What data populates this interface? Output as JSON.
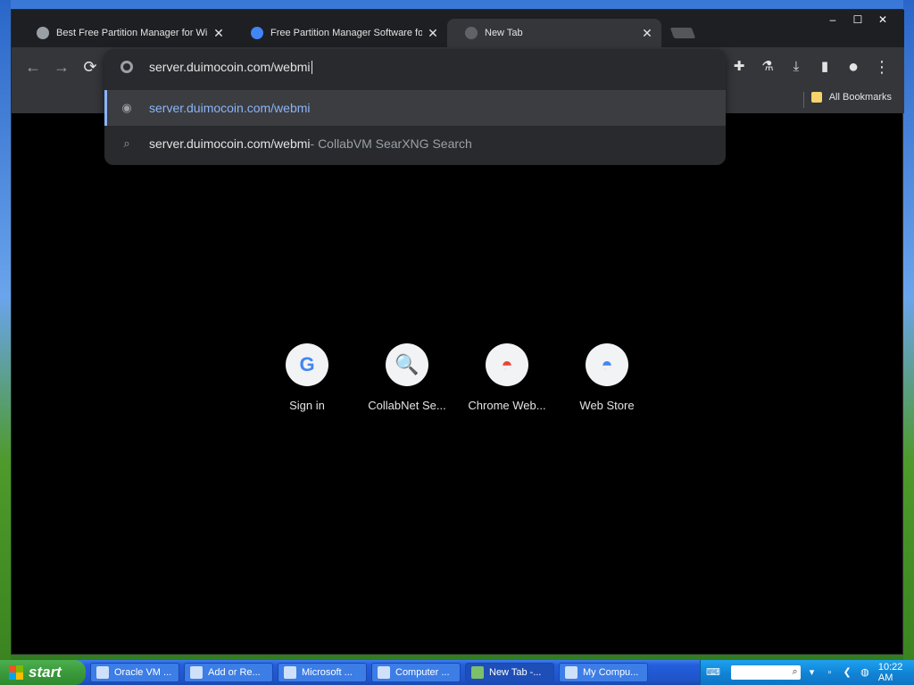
{
  "window": {
    "minimize": "–",
    "maximize": "☐",
    "close": "✕"
  },
  "tabs": [
    {
      "title": "Best Free Partition Manager for Wi",
      "close": "✕",
      "favicon_color": "#9aa0a6"
    },
    {
      "title": "Free Partition Manager Software fo",
      "close": "✕",
      "favicon_color": "#4285f4"
    },
    {
      "title": "New Tab",
      "close": "✕",
      "favicon_color": "#5f6368"
    }
  ],
  "toolbar": {
    "back": "←",
    "forward": "→",
    "reload": "⟳",
    "extensions": "✚",
    "labs": "⚗",
    "download": "⤓",
    "sidepanel": "▮",
    "profile": "●",
    "menu": "⋮"
  },
  "omnibox": {
    "input_value": "server.duimocoin.com/webmi",
    "suggestions": [
      {
        "icon": "globe-icon",
        "main": "server.duimocoin.com/webmi",
        "sub": ""
      },
      {
        "icon": "search-icon",
        "main": "server.duimocoin.com/webmi",
        "sub": " - CollabVM SearXNG Search"
      }
    ]
  },
  "bookmarks": {
    "folder_label": "All Bookmarks"
  },
  "shortcuts": [
    {
      "label": "Sign in",
      "glyph": "G",
      "color": "#4285f4"
    },
    {
      "label": "CollabNet Se...",
      "glyph": "🔍",
      "color": "#1a73e8"
    },
    {
      "label": "Chrome Web...",
      "glyph": "◓",
      "color": "#ea4335"
    },
    {
      "label": "Web Store",
      "glyph": "◓",
      "color": "#4285f4"
    }
  ],
  "taskbar": {
    "start_label": "start",
    "tasks": [
      {
        "label": "Oracle VM ..."
      },
      {
        "label": "Add or Re..."
      },
      {
        "label": "Microsoft ..."
      },
      {
        "label": "Computer ..."
      },
      {
        "label": "New Tab -..."
      },
      {
        "label": "My Compu..."
      }
    ],
    "clock": "10:22 AM"
  }
}
